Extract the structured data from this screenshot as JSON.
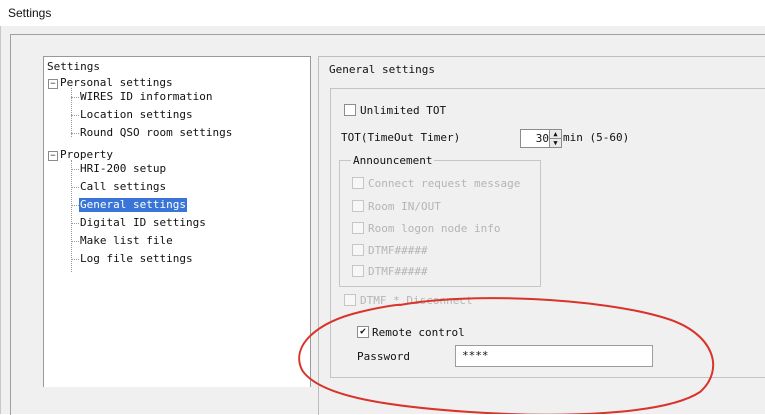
{
  "window": {
    "title": "Settings"
  },
  "tree": {
    "root": "Settings",
    "personal": {
      "label": "Personal settings",
      "expander": "−",
      "items": [
        "WIRES ID information",
        "Location settings",
        "Round QSO room settings"
      ]
    },
    "property": {
      "label": "Property",
      "expander": "−",
      "items": [
        "HRI-200 setup",
        "Call settings",
        "General settings",
        "Digital ID settings",
        "Make list file",
        "Log file settings"
      ]
    },
    "selected_item": "General settings"
  },
  "general": {
    "group_title": "General settings",
    "unlimited_tot": {
      "label": "Unlimited TOT",
      "checked": false
    },
    "tot": {
      "label": "TOT(TimeOut Timer)",
      "value": "30",
      "unit": "min (5-60)"
    },
    "announcement": {
      "title": "Announcement",
      "items": [
        {
          "label": "Connect request message",
          "checked": false
        },
        {
          "label": "Room IN/OUT",
          "checked": false
        },
        {
          "label": "Room logon node info",
          "checked": false
        },
        {
          "label": "DTMF#####",
          "checked": false
        },
        {
          "label": "DTMF#####",
          "checked": false
        }
      ]
    },
    "dtmf_disconnect": {
      "label": "DTMF * Disconnect",
      "checked": false
    },
    "remote_control": {
      "label": "Remote control",
      "checked": true,
      "check_glyph": "✔"
    },
    "password": {
      "label": "Password",
      "value": "****"
    }
  },
  "icons": {
    "spin_up": "▲",
    "spin_down": "▼"
  },
  "colors": {
    "selection": "#3875d7",
    "annotation": "#d9332b"
  }
}
